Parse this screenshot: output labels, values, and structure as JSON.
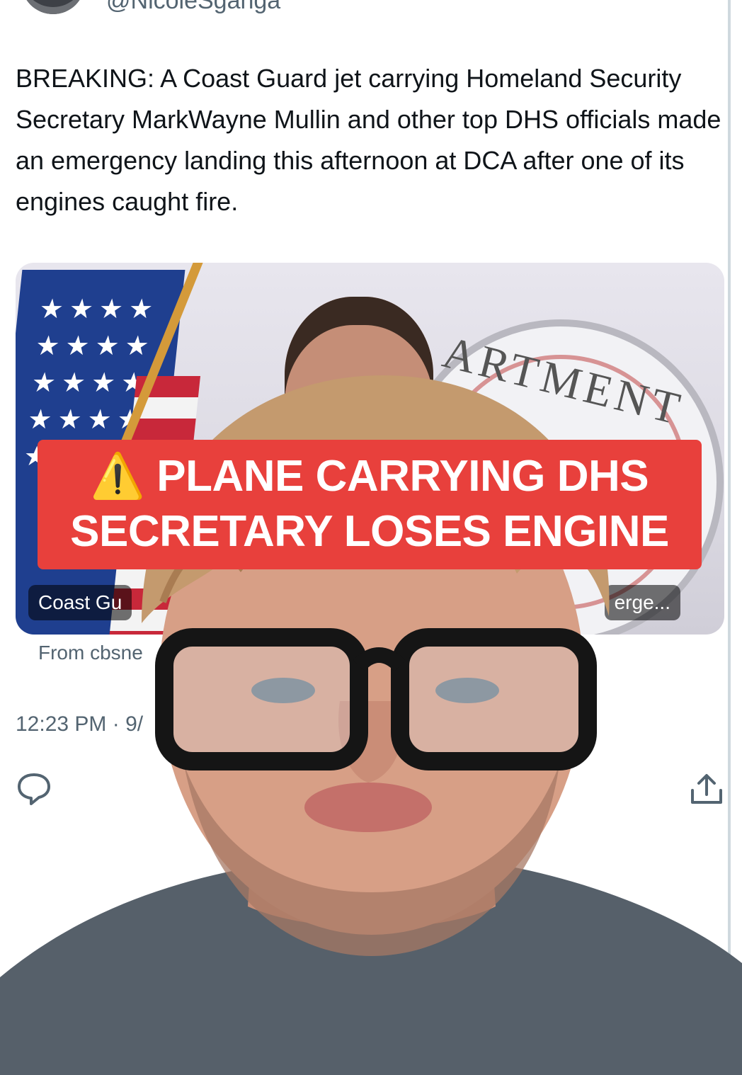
{
  "tweet": {
    "text": "BREAKING: A Coast Guard jet carrying Homeland Security Secretary MarkWayne Mullin and other top DHS officials made an emergency landing this afternoon at DCA after one of its engines caught fire.",
    "handle": "@NicoleSganga",
    "media": {
      "caption_left": "Coast Gu",
      "caption_right": "erge...",
      "seal_text": "ARTMENT"
    },
    "source": "From cbsne",
    "timestamp": "12:23 PM · 9/"
  },
  "overlay": {
    "warning_icon": "⚠️",
    "line1": "PLANE CARRYING DHS",
    "line2": "SECRETARY LOSES ENGINE"
  },
  "actions": {
    "reply_icon": "reply-icon",
    "share_icon": "share-icon"
  },
  "colors": {
    "banner": "#e8403c",
    "text": "#0f1419",
    "secondary_text": "#536471"
  }
}
